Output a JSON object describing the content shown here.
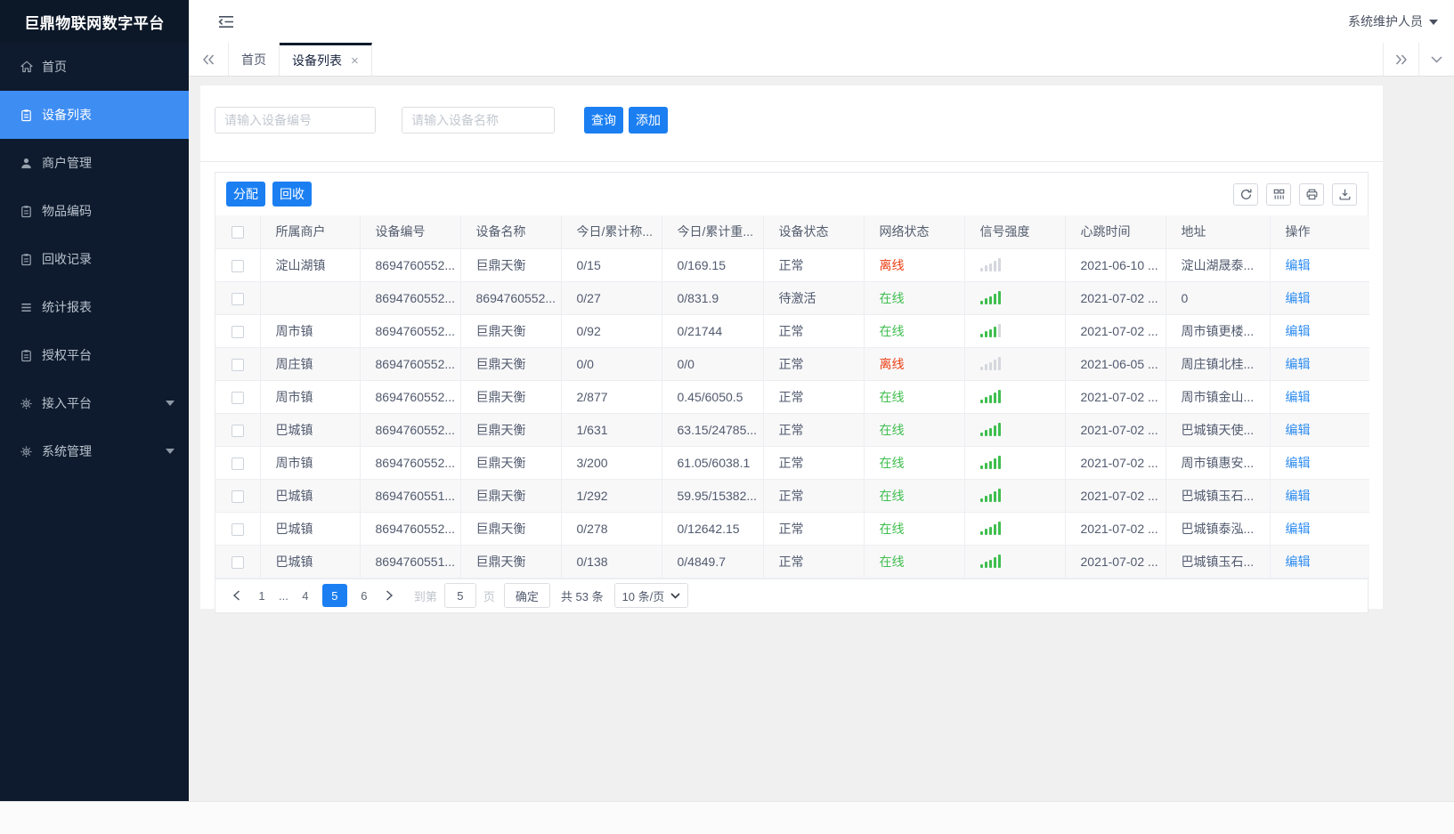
{
  "app": {
    "title": "巨鼎物联网数字平台",
    "user": "系统维护人员"
  },
  "colors": {
    "accent": "#1b7ff2",
    "sidebar_active": "#3e8df3",
    "offline_red": "#ed3f14",
    "online_green": "#3fbe4e",
    "link_blue": "#2d8cf0",
    "sidebar_bg": "#0e1b2e"
  },
  "sidebar": {
    "items": [
      {
        "key": "home",
        "label": "首页",
        "icon": "home-icon",
        "active": false,
        "arrow": false
      },
      {
        "key": "device-list",
        "label": "设备列表",
        "icon": "clipboard-icon",
        "active": true,
        "arrow": false
      },
      {
        "key": "merchant-mgmt",
        "label": "商户管理",
        "icon": "user-icon",
        "active": false,
        "arrow": false
      },
      {
        "key": "item-code",
        "label": "物品编码",
        "icon": "clipboard-icon",
        "active": false,
        "arrow": false
      },
      {
        "key": "recycle-records",
        "label": "回收记录",
        "icon": "clipboard-icon",
        "active": false,
        "arrow": false
      },
      {
        "key": "statistics-report",
        "label": "统计报表",
        "icon": "list-icon",
        "active": false,
        "arrow": false
      },
      {
        "key": "authorization",
        "label": "授权平台",
        "icon": "clipboard-icon",
        "active": false,
        "arrow": false
      },
      {
        "key": "access-platform",
        "label": "接入平台",
        "icon": "gear-icon",
        "active": false,
        "arrow": true
      },
      {
        "key": "system-mgmt",
        "label": "系统管理",
        "icon": "gear-icon",
        "active": false,
        "arrow": true
      }
    ]
  },
  "tabs": {
    "items": [
      {
        "key": "home",
        "label": "首页",
        "active": false,
        "closable": false
      },
      {
        "key": "device-list",
        "label": "设备列表",
        "active": true,
        "closable": true
      }
    ]
  },
  "search": {
    "device_no_placeholder": "请输入设备编号",
    "device_name_placeholder": "请输入设备名称",
    "query_label": "查询",
    "add_label": "添加"
  },
  "toolbar": {
    "assign_label": "分配",
    "recycle_label": "回收",
    "icons": [
      "refresh-icon",
      "columns-icon",
      "print-icon",
      "export-icon"
    ]
  },
  "table": {
    "columns": [
      "所属商户",
      "设备编号",
      "设备名称",
      "今日/累计称...",
      "今日/累计重...",
      "设备状态",
      "网络状态",
      "信号强度",
      "心跳时间",
      "地址",
      "操作"
    ],
    "rows": [
      {
        "merchant": "淀山湖镇",
        "device_no": "8694760552...",
        "device_name": "巨鼎天衡",
        "today_count": "0/15",
        "today_weight": "0/169.15",
        "device_status": "正常",
        "network_status": "离线",
        "online": false,
        "signal_bars": 0,
        "heartbeat": "2021-06-10 ...",
        "address": "淀山湖晟泰...",
        "action": "编辑"
      },
      {
        "merchant": "",
        "device_no": "8694760552...",
        "device_name": "8694760552...",
        "today_count": "0/27",
        "today_weight": "0/831.9",
        "device_status": "待激活",
        "network_status": "在线",
        "online": true,
        "signal_bars": 5,
        "heartbeat": "2021-07-02 ...",
        "address": "0",
        "action": "编辑"
      },
      {
        "merchant": "周市镇",
        "device_no": "8694760552...",
        "device_name": "巨鼎天衡",
        "today_count": "0/92",
        "today_weight": "0/21744",
        "device_status": "正常",
        "network_status": "在线",
        "online": true,
        "signal_bars": 4,
        "heartbeat": "2021-07-02 ...",
        "address": "周市镇更楼...",
        "action": "编辑"
      },
      {
        "merchant": "周庄镇",
        "device_no": "8694760552...",
        "device_name": "巨鼎天衡",
        "today_count": "0/0",
        "today_weight": "0/0",
        "device_status": "正常",
        "network_status": "离线",
        "online": false,
        "signal_bars": 0,
        "heartbeat": "2021-06-05 ...",
        "address": "周庄镇北桂...",
        "action": "编辑"
      },
      {
        "merchant": "周市镇",
        "device_no": "8694760552...",
        "device_name": "巨鼎天衡",
        "today_count": "2/877",
        "today_weight": "0.45/6050.5",
        "device_status": "正常",
        "network_status": "在线",
        "online": true,
        "signal_bars": 5,
        "heartbeat": "2021-07-02 ...",
        "address": "周市镇金山...",
        "action": "编辑"
      },
      {
        "merchant": "巴城镇",
        "device_no": "8694760552...",
        "device_name": "巨鼎天衡",
        "today_count": "1/631",
        "today_weight": "63.15/24785...",
        "device_status": "正常",
        "network_status": "在线",
        "online": true,
        "signal_bars": 5,
        "heartbeat": "2021-07-02 ...",
        "address": "巴城镇天使...",
        "action": "编辑"
      },
      {
        "merchant": "周市镇",
        "device_no": "8694760552...",
        "device_name": "巨鼎天衡",
        "today_count": "3/200",
        "today_weight": "61.05/6038.1",
        "device_status": "正常",
        "network_status": "在线",
        "online": true,
        "signal_bars": 5,
        "heartbeat": "2021-07-02 ...",
        "address": "周市镇惠安...",
        "action": "编辑"
      },
      {
        "merchant": "巴城镇",
        "device_no": "8694760551...",
        "device_name": "巨鼎天衡",
        "today_count": "1/292",
        "today_weight": "59.95/15382...",
        "device_status": "正常",
        "network_status": "在线",
        "online": true,
        "signal_bars": 5,
        "heartbeat": "2021-07-02 ...",
        "address": "巴城镇玉石...",
        "action": "编辑"
      },
      {
        "merchant": "巴城镇",
        "device_no": "8694760552...",
        "device_name": "巨鼎天衡",
        "today_count": "0/278",
        "today_weight": "0/12642.15",
        "device_status": "正常",
        "network_status": "在线",
        "online": true,
        "signal_bars": 5,
        "heartbeat": "2021-07-02 ...",
        "address": "巴城镇泰泓...",
        "action": "编辑"
      },
      {
        "merchant": "巴城镇",
        "device_no": "8694760551...",
        "device_name": "巨鼎天衡",
        "today_count": "0/138",
        "today_weight": "0/4849.7",
        "device_status": "正常",
        "network_status": "在线",
        "online": true,
        "signal_bars": 5,
        "heartbeat": "2021-07-02 ...",
        "address": "巴城镇玉石...",
        "action": "编辑"
      }
    ]
  },
  "pagination": {
    "pages": [
      "1",
      "...",
      "4",
      "5",
      "6"
    ],
    "active_page": "5",
    "goto_label": "到第",
    "goto_value": "5",
    "goto_unit": "页",
    "confirm_label": "确定",
    "total_label": "共 53 条",
    "page_size_label": "10 条/页"
  }
}
